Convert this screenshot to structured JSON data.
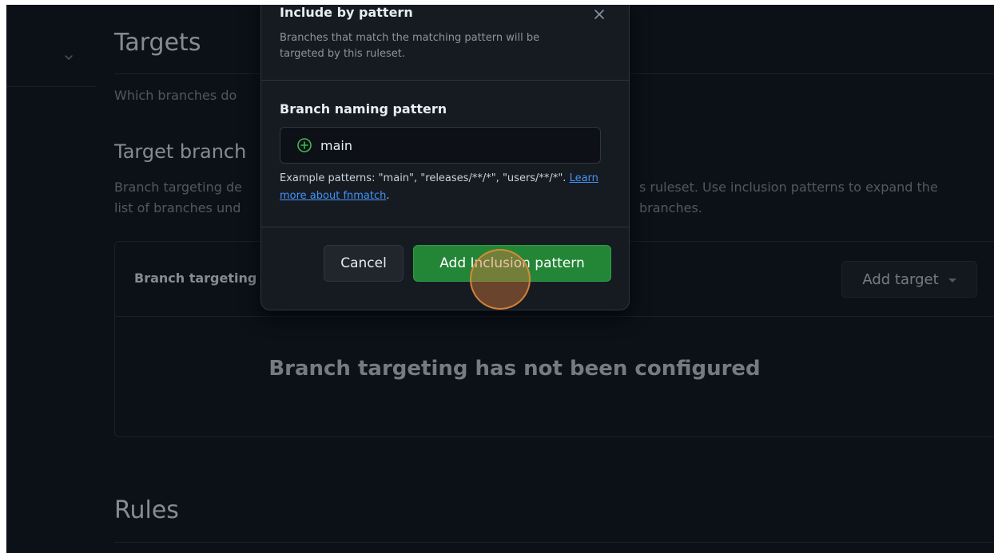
{
  "sections": {
    "targets_title": "Targets",
    "targets_desc": "Which branches do",
    "target_branches_title": "Target branch",
    "target_branches_desc_left_1": "Branch targeting de",
    "target_branches_desc_left_2": "list of branches und",
    "target_branches_desc_right_1": "s ruleset. Use inclusion patterns to expand the",
    "target_branches_desc_right_2": "branches.",
    "rules_title": "Rules"
  },
  "targeting_box": {
    "header_label": "Branch targeting",
    "add_target_label": "Add target",
    "empty_message": "Branch targeting has not been configured"
  },
  "dialog": {
    "title": "Include by pattern",
    "subtitle": "Branches that match the matching pattern will be targeted by this ruleset.",
    "field_label": "Branch naming pattern",
    "field_value": "main",
    "hint_text": "Example patterns: \"main\", \"releases/**/*\", \"users/**/*\". ",
    "hint_link": "Learn more about fnmatch",
    "hint_end": ".",
    "cancel_label": "Cancel",
    "add_label": "Add Inclusion pattern"
  },
  "colors": {
    "background": "#161b22",
    "accent_green": "#238636",
    "link_blue": "#4493f8"
  }
}
